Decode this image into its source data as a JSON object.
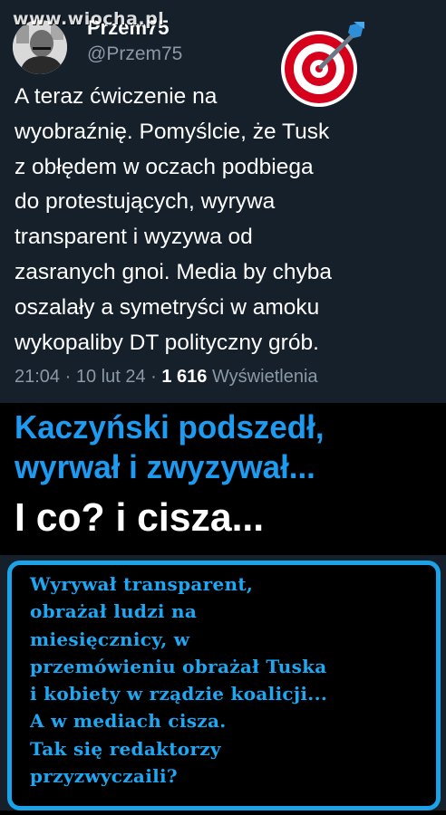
{
  "watermark": "www.wiocha.pl",
  "tweet": {
    "display_name": "Przem75",
    "handle": "@Przem75",
    "emoji_icon": "direct-hit-target",
    "text": "A teraz ćwiczenie na\nwyobraźnię. Pomyślcie, że Tusk\nz obłędem w oczach podbiega\ndo protestujących, wyrywa\ntransparent i wyzywa od\nzasranych gnoi. Media by chyba\noszalały a symetryści w amoku\nwykopaliby DT polityczny grób.",
    "time": "21:04",
    "date": "10 lut 24",
    "views_count": "1 616",
    "views_label": "Wyświetlenia"
  },
  "headline": {
    "line1": "Kaczyński podszedł,",
    "line2": "wyrwał i zwyzywał...",
    "line3": "I co? i cisza..."
  },
  "comment": {
    "text": "Wyrywał transparent,\nobrażał ludzi na\nmiesięcznicy, w\nprzemówieniu obrażał Tuska\ni kobiety w rządzie koalicji...\nA w mediach cisza.\nTak się redaktorzy\nprzyzwyczaili?"
  },
  "colors": {
    "tweet_bg": "#15202b",
    "accent_blue": "#1d9bf0",
    "muted_text": "#8b98a5",
    "comment_border": "#1aa3e8"
  }
}
